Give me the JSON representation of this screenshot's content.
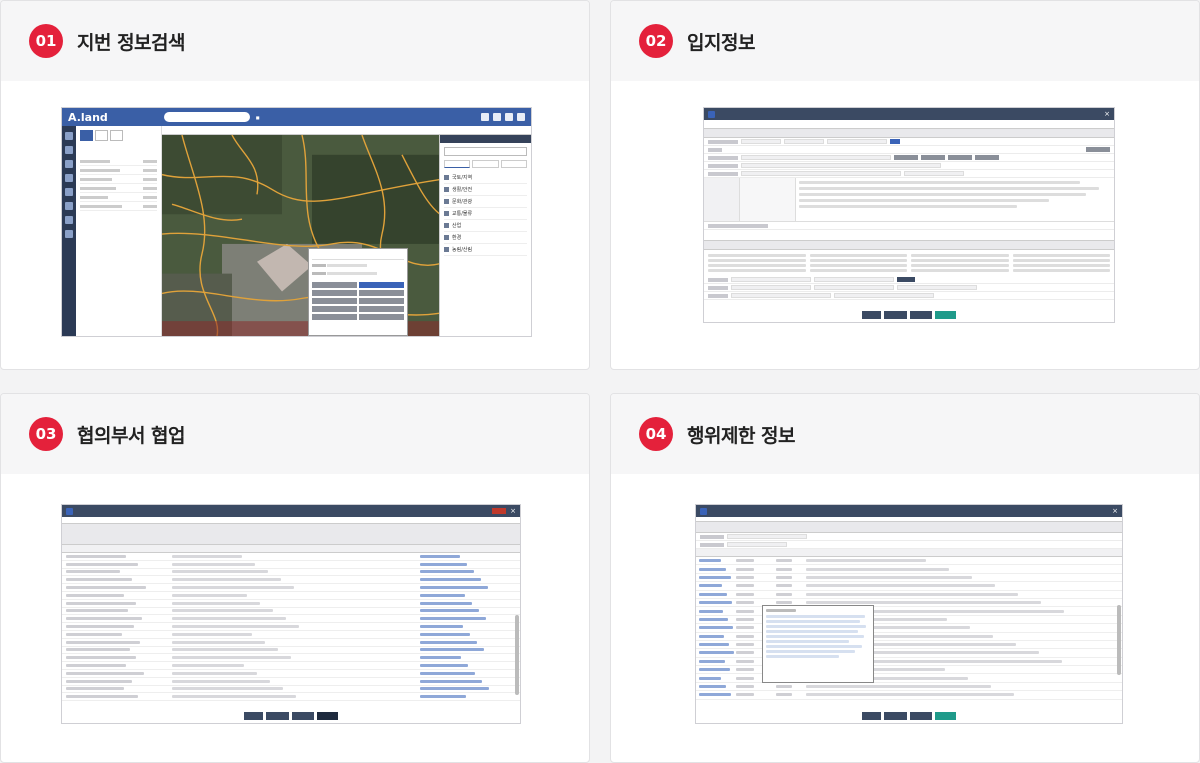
{
  "cards": [
    {
      "num": "01",
      "title": "지번 정보검색"
    },
    {
      "num": "02",
      "title": "입지정보"
    },
    {
      "num": "03",
      "title": "협의부서 협업"
    },
    {
      "num": "04",
      "title": "행위제한 정보"
    }
  ],
  "aland": {
    "logo": "A.land",
    "categories": [
      "국토/지역",
      "생활/안전",
      "문화/관광",
      "교통/물류",
      "산업",
      "환경",
      "농림/산림"
    ]
  },
  "colors": {
    "accent": "#e4213b",
    "window_bar": "#3b4a63",
    "map_road": "#e0a23a",
    "active_step": "#1f9a8a"
  }
}
